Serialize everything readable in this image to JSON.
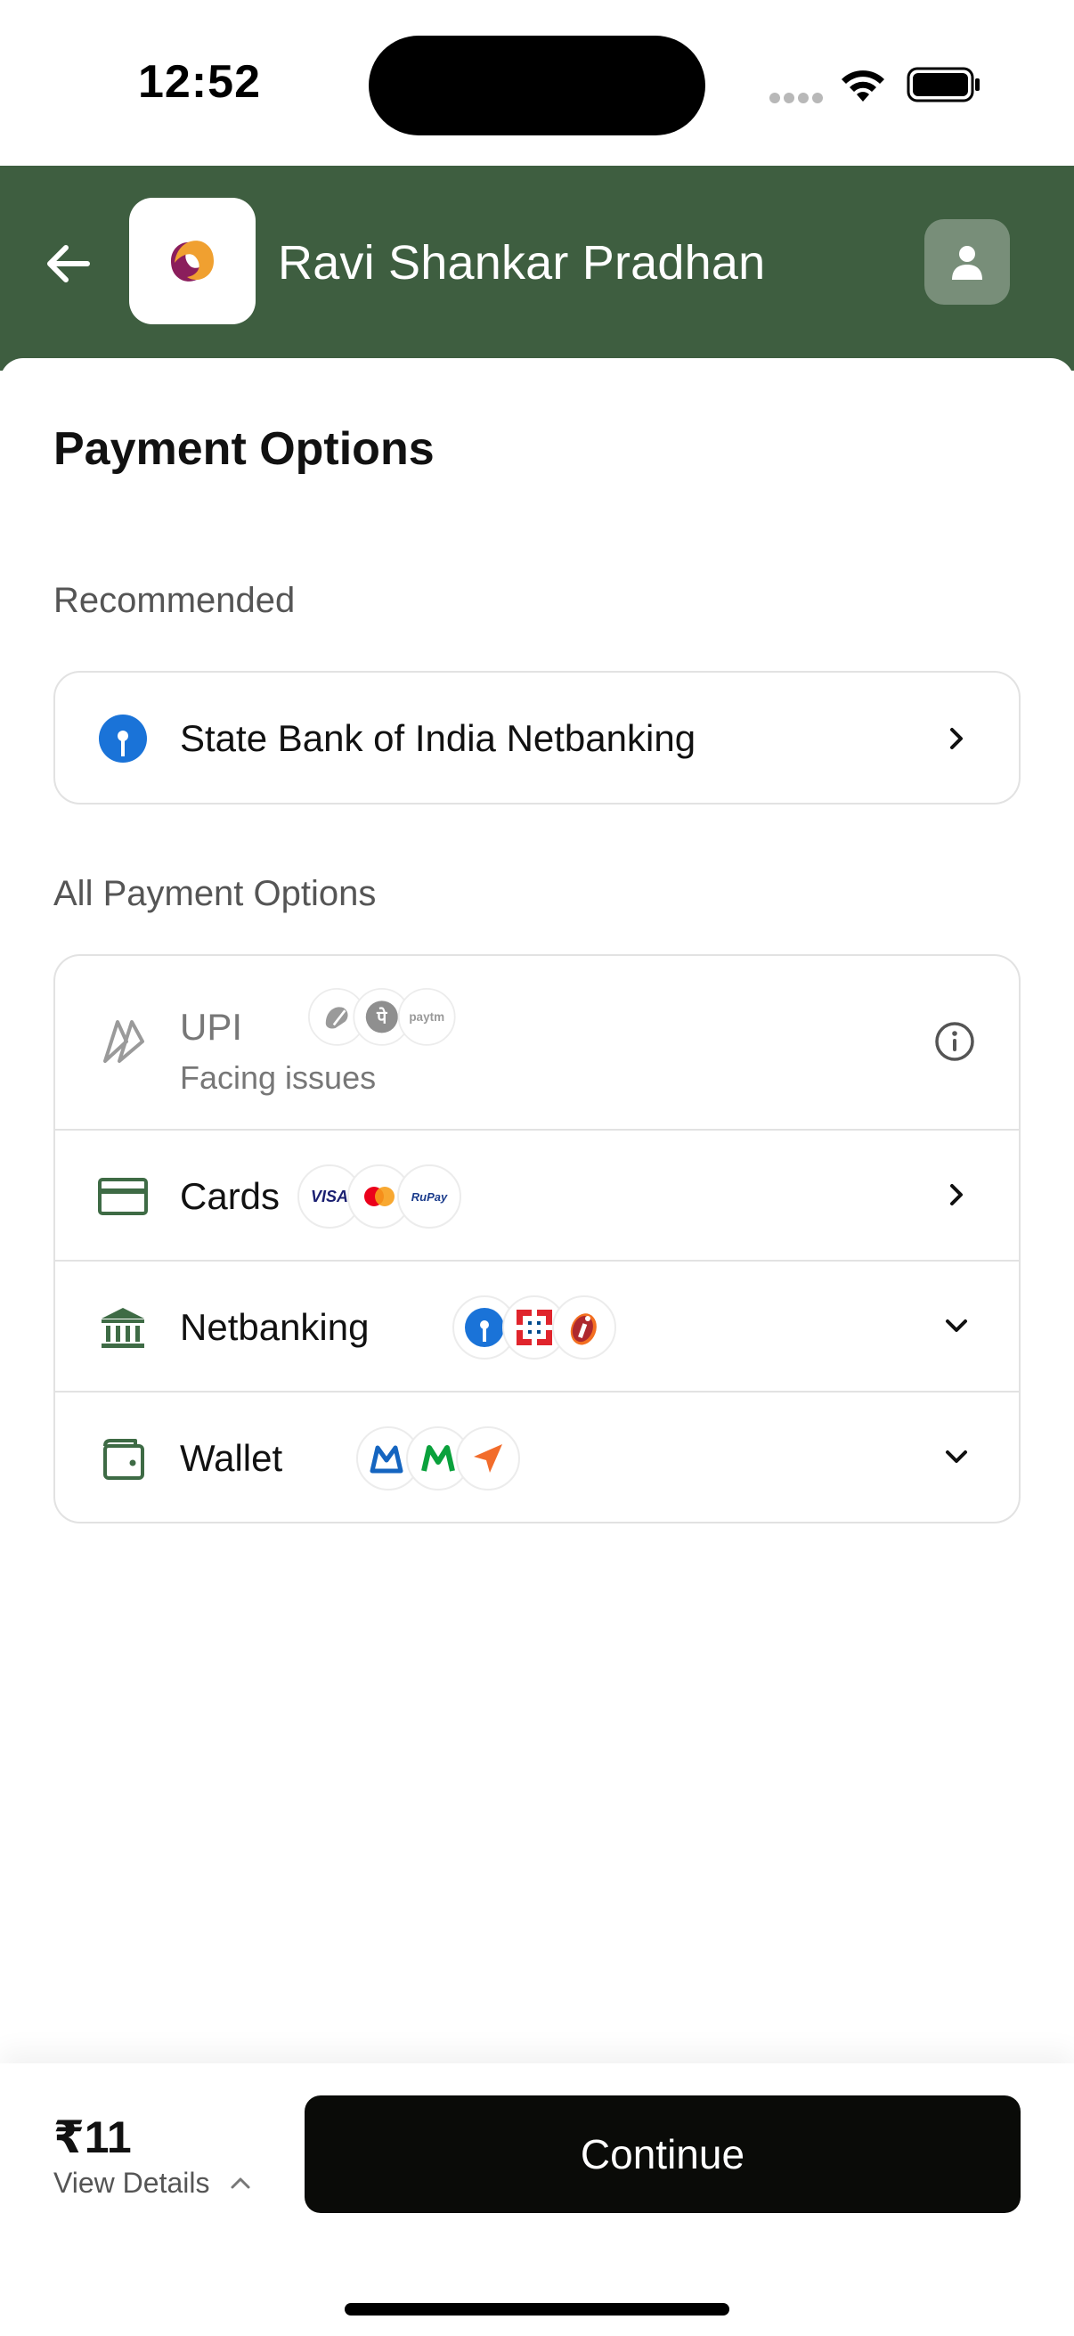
{
  "status_bar": {
    "time": "12:52"
  },
  "header": {
    "merchant_name": "Ravi Shankar Pradhan"
  },
  "page_title": "Payment Options",
  "recommended": {
    "label": "Recommended",
    "item": {
      "label": "State Bank of India Netbanking",
      "icon": "sbi-icon"
    }
  },
  "all_options": {
    "label": "All Payment Options",
    "upi": {
      "label": "UPI",
      "status": "Facing issues",
      "badges": [
        "gpay-icon",
        "phonepe-icon",
        "paytm-icon"
      ],
      "paytm_text": "paytm"
    },
    "cards": {
      "label": "Cards",
      "badges": [
        "VISA",
        "mastercard-icon",
        "RuPay"
      ]
    },
    "netbanking": {
      "label": "Netbanking",
      "badges": [
        "sbi-icon",
        "hdfc-icon",
        "icici-icon"
      ]
    },
    "wallet": {
      "label": "Wallet",
      "badges": [
        "mobikwik-icon",
        "m-wallet-icon",
        "freecharge-icon"
      ]
    }
  },
  "footer": {
    "amount": "₹11",
    "view_details_label": "View Details",
    "continue_label": "Continue"
  },
  "colors": {
    "header_bg": "#3e5e40",
    "icon_green": "#3e6b45",
    "button_bg": "#0a0b08"
  }
}
